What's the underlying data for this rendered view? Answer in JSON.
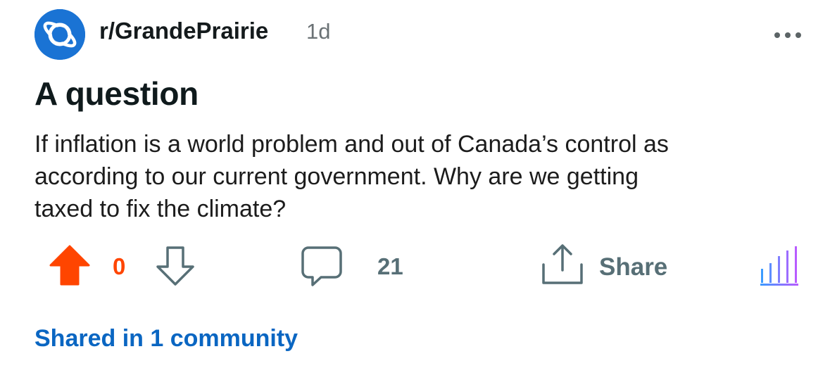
{
  "post": {
    "community": "r/GrandePrairie",
    "age": "1d",
    "title": "A question",
    "body": "If inflation is a world problem and out of Canada’s control as\naccording to our current government.  Why are we getting\ntaxed to fix the climate?",
    "score": "0",
    "comment_count": "21",
    "share_label": "Share",
    "shared_in": "Shared in 1 community"
  },
  "icons": {
    "avatar": "reddit-planet-icon",
    "more": "more-dots-icon",
    "upvote": "upvote-arrow-icon",
    "downvote": "downvote-arrow-icon",
    "comment": "comment-bubble-icon",
    "share": "share-icon",
    "stats": "insights-bars-icon"
  },
  "colors": {
    "avatar_bg": "#1a73d4",
    "upvote_active": "#ff4500",
    "icon_gray": "#576f76",
    "link_blue": "#0a66c2",
    "stats_gradient": [
      "#3b9bff",
      "#b85cff"
    ]
  }
}
